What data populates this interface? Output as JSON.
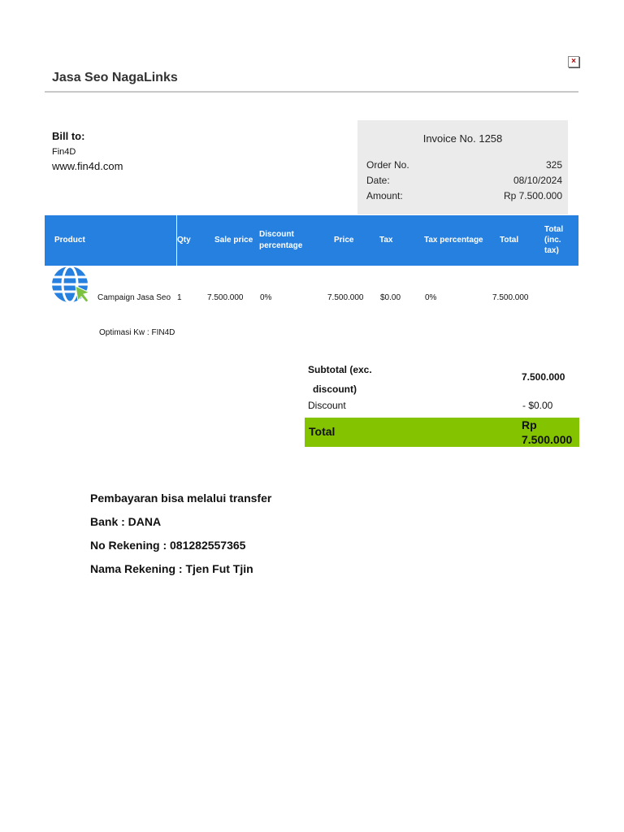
{
  "header": {
    "brand": "Jasa Seo NagaLinks",
    "close_glyph": "×"
  },
  "bill_to": {
    "label": "Bill to:",
    "customer": "Fin4D",
    "website": "www.fin4d.com"
  },
  "invoice": {
    "title": "Invoice No. 1258",
    "order_label": "Order No.",
    "order_value": "325",
    "date_label": "Date:",
    "date_value": "08/10/2024",
    "amount_label": "Amount:",
    "amount_value": "Rp 7.500.000"
  },
  "table": {
    "headers": {
      "product": "Product",
      "qty": "Qty",
      "sale_price": "Sale price",
      "discount_1": "Discount",
      "discount_2": "percentage",
      "price": "Price",
      "tax": "Tax",
      "tax_percentage": "Tax percentage",
      "total": "Total",
      "total_inc_1": "Total",
      "total_inc_2": "(inc.",
      "total_inc_3": "tax)"
    },
    "row": {
      "product": "Campaign Jasa Seo",
      "qty": "1",
      "sale_price": "7.500.000",
      "discount": "0%",
      "price": "7.500.000",
      "tax": "$0.00",
      "tax_percentage": "0%",
      "total": "7.500.000",
      "note": "Optimasi Kw : FIN4D"
    }
  },
  "summary": {
    "subtotal_label_1": "Subtotal (exc.",
    "subtotal_label_2": "discount)",
    "subtotal_value": "7.500.000",
    "discount_label": "Discount",
    "discount_value": "- $0.00",
    "total_label": "Total",
    "total_value_1": "Rp",
    "total_value_2": "7.500.000"
  },
  "payment": {
    "line1": "Pembayaran bisa melalui transfer",
    "line2": "Bank : DANA",
    "line3": "No Rekening : 081282557365",
    "line4": "Nama Rekening : Tjen Fut Tjin"
  },
  "colors": {
    "header_blue": "#2680e0",
    "total_green": "#84c300",
    "invoice_box": "#ebebeb"
  }
}
